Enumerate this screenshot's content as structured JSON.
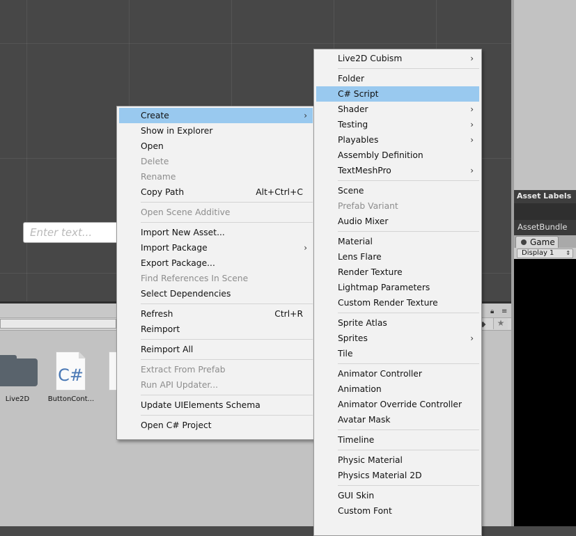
{
  "scene": {
    "text_input_placeholder": "Enter text..."
  },
  "right_panel": {
    "asset_labels": "Asset Labels",
    "asset_bundle": "AssetBundle",
    "game_tab": "Game",
    "display": "Display 1"
  },
  "project": {
    "assets": [
      {
        "label": "Live2D"
      },
      {
        "label": "ButtonCont..."
      }
    ],
    "cs_glyph": "C#"
  },
  "context_menu": {
    "items": [
      {
        "label": "Create",
        "submenu": true,
        "highlighted": true
      },
      {
        "label": "Show in Explorer"
      },
      {
        "label": "Open"
      },
      {
        "label": "Delete",
        "disabled": true
      },
      {
        "label": "Rename",
        "disabled": true
      },
      {
        "label": "Copy Path",
        "shortcut": "Alt+Ctrl+C"
      },
      {
        "label": "Open Scene Additive",
        "disabled": true
      },
      {
        "label": "Import New Asset..."
      },
      {
        "label": "Import Package",
        "submenu": true
      },
      {
        "label": "Export Package..."
      },
      {
        "label": "Find References In Scene",
        "disabled": true
      },
      {
        "label": "Select Dependencies"
      },
      {
        "label": "Refresh",
        "shortcut": "Ctrl+R"
      },
      {
        "label": "Reimport"
      },
      {
        "label": "Reimport All"
      },
      {
        "label": "Extract From Prefab",
        "disabled": true
      },
      {
        "label": "Run API Updater...",
        "disabled": true
      },
      {
        "label": "Update UIElements Schema"
      },
      {
        "label": "Open C# Project"
      }
    ]
  },
  "create_submenu": {
    "items": [
      {
        "label": "Live2D Cubism",
        "submenu": true
      },
      {
        "label": "Folder"
      },
      {
        "label": "C# Script",
        "highlighted": true
      },
      {
        "label": "Shader",
        "submenu": true
      },
      {
        "label": "Testing",
        "submenu": true
      },
      {
        "label": "Playables",
        "submenu": true
      },
      {
        "label": "Assembly Definition"
      },
      {
        "label": "TextMeshPro",
        "submenu": true
      },
      {
        "label": "Scene"
      },
      {
        "label": "Prefab Variant",
        "disabled": true
      },
      {
        "label": "Audio Mixer"
      },
      {
        "label": "Material"
      },
      {
        "label": "Lens Flare"
      },
      {
        "label": "Render Texture"
      },
      {
        "label": "Lightmap Parameters"
      },
      {
        "label": "Custom Render Texture"
      },
      {
        "label": "Sprite Atlas"
      },
      {
        "label": "Sprites",
        "submenu": true
      },
      {
        "label": "Tile"
      },
      {
        "label": "Animator Controller"
      },
      {
        "label": "Animation"
      },
      {
        "label": "Animator Override Controller"
      },
      {
        "label": "Avatar Mask"
      },
      {
        "label": "Timeline"
      },
      {
        "label": "Physic Material"
      },
      {
        "label": "Physics Material 2D"
      },
      {
        "label": "GUI Skin"
      },
      {
        "label": "Custom Font"
      }
    ]
  },
  "colors": {
    "highlight": "#99c9ef",
    "menu_bg": "#f2f2f2",
    "disabled_text": "#8d8d8d"
  }
}
